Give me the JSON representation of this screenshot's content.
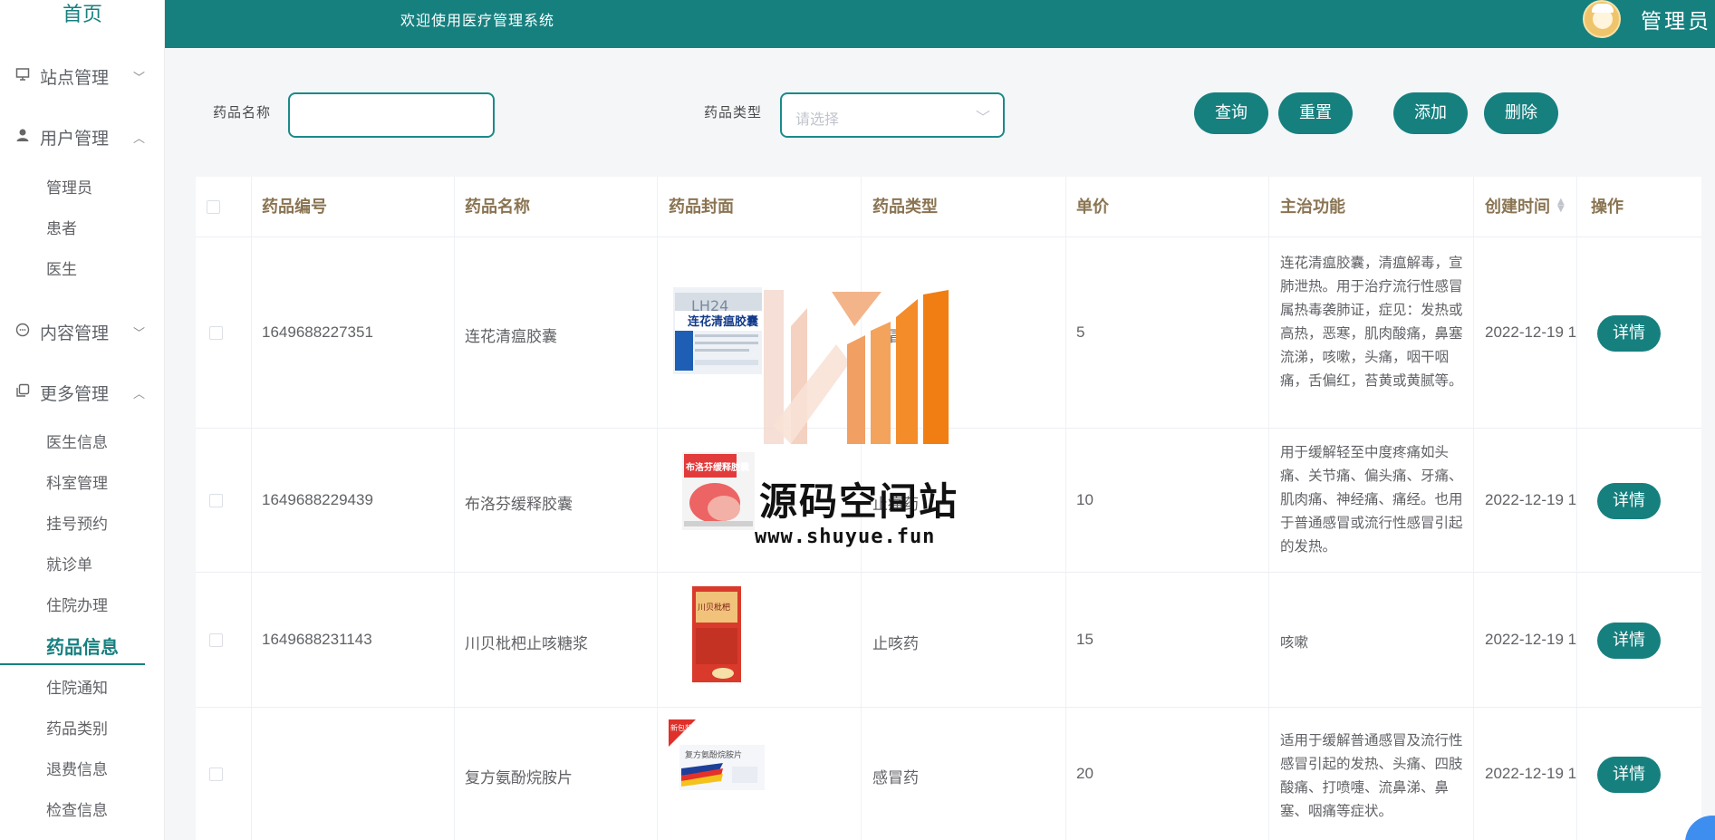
{
  "header": {
    "welcome": "欢迎使用医疗管理系统",
    "user": "管理员"
  },
  "sidebar": {
    "home": "首页",
    "groups": [
      {
        "label": "站点管理",
        "icon": "monitor-icon",
        "expanded": false
      },
      {
        "label": "用户管理",
        "icon": "user-icon",
        "expanded": true
      },
      {
        "label": "内容管理",
        "icon": "chat-icon",
        "expanded": false
      },
      {
        "label": "更多管理",
        "icon": "copy-icon",
        "expanded": true
      }
    ],
    "user_items": [
      "管理员",
      "患者",
      "医生"
    ],
    "more_items": [
      "医生信息",
      "科室管理",
      "挂号预约",
      "就诊单",
      "住院办理",
      "药品信息",
      "住院通知",
      "药品类别",
      "退费信息",
      "检查信息"
    ],
    "active_item": "药品信息"
  },
  "search": {
    "name_label": "药品名称",
    "name_value": "",
    "type_label": "药品类型",
    "type_placeholder": "请选择",
    "query": "查询",
    "reset": "重置",
    "add": "添加",
    "delete": "删除"
  },
  "table": {
    "columns": [
      "药品编号",
      "药品名称",
      "药品封面",
      "药品类型",
      "单价",
      "主治功能",
      "创建时间",
      "操作"
    ],
    "detail_label": "详情",
    "rows": [
      {
        "id": "1649688227351",
        "name": "连花清瘟胶囊",
        "type": "感冒药",
        "price": "5",
        "func": "连花清瘟胶囊，清瘟解毒，宣肺泄热。用于治疗流行性感冒属热毒袭肺证，症见：发热或高热，恶寒，肌肉酸痛，鼻塞流涕，咳嗽，头痛，咽干咽痛，舌偏红，苔黄或黄腻等。",
        "created": "2022-12-19 1",
        "cover_text": "连花清瘟胶囊",
        "cover_sub": "LH24"
      },
      {
        "id": "1649688229439",
        "name": "布洛芬缓释胶囊",
        "type": "止痛药",
        "price": "10",
        "func": "用于缓解轻至中度疼痛如头痛、关节痛、偏头痛、牙痛、肌肉痛、神经痛、痛经。也用于普通感冒或流行性感冒引起的发热。",
        "created": "2022-12-19 1",
        "cover_text": "布洛芬缓释胶囊"
      },
      {
        "id": "1649688231143",
        "name": "川贝枇杷止咳糖浆",
        "type": "止咳药",
        "price": "15",
        "func": "咳嗽",
        "created": "2022-12-19 1",
        "cover_text": "川贝枇杷"
      },
      {
        "id": "",
        "name": "复方氨酚烷胺片",
        "type": "感冒药",
        "price": "20",
        "func": "适用于缓解普通感冒及流行性感冒引起的发热、头痛、四肢酸痛、打喷嚏、流鼻涕、鼻塞、咽痛等症状。",
        "created": "2022-12-19 1",
        "cover_text": "复方氨酚烷胺片",
        "cover_sub": "新包装"
      }
    ]
  },
  "watermark": {
    "title": "源码空间站",
    "url": "www.shuyue.fun"
  },
  "colors": {
    "primary": "#16807f",
    "header_text": "#8a7452"
  }
}
